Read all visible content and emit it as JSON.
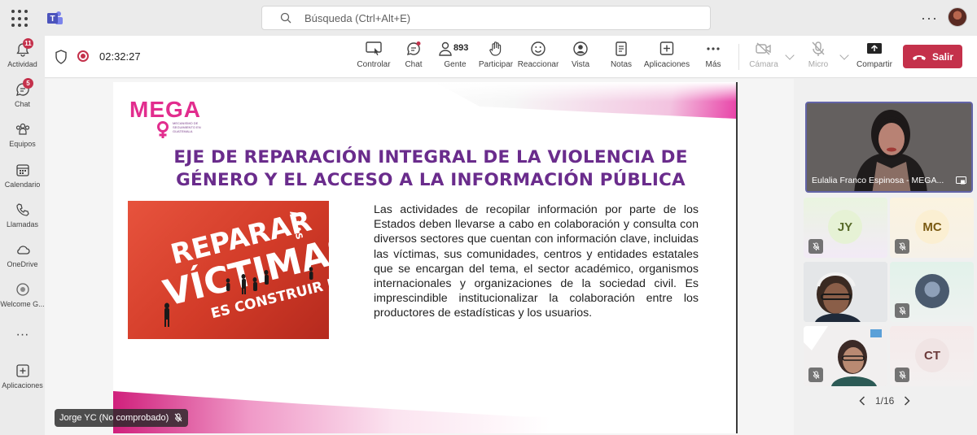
{
  "topbar": {
    "search_placeholder": "Búsqueda (Ctrl+Alt+E)",
    "more_label": "···"
  },
  "rail": {
    "items": [
      {
        "label": "Actividad",
        "badge": "11"
      },
      {
        "label": "Chat",
        "badge": "5"
      },
      {
        "label": "Equipos"
      },
      {
        "label": "Calendario"
      },
      {
        "label": "Llamadas"
      },
      {
        "label": "OneDrive"
      },
      {
        "label": "Welcome G..."
      },
      {
        "label": "···"
      },
      {
        "label": "Aplicaciones"
      }
    ]
  },
  "meeting": {
    "timer": "02:32:27",
    "people_count": "893",
    "toolbar": [
      {
        "label": "Controlar"
      },
      {
        "label": "Chat"
      },
      {
        "label": "Gente"
      },
      {
        "label": "Participar"
      },
      {
        "label": "Reaccionar"
      },
      {
        "label": "Vista"
      },
      {
        "label": "Notas"
      },
      {
        "label": "Aplicaciones"
      },
      {
        "label": "Más"
      },
      {
        "label": "Cámara"
      },
      {
        "label": "Micro"
      },
      {
        "label": "Compartir"
      }
    ],
    "leave_label": "Salir"
  },
  "slide": {
    "logo": "MEGA",
    "logo_sub": "MECANISMO DE SEGUIMIENTO EN GUATEMALA",
    "title_line1": "EJE DE REPARACIÓN INTEGRAL DE LA VIOLENCIA DE",
    "title_line2": "GÉNERO  Y EL ACCESO A LA INFORMACIÓN PÚBLICA",
    "image_text1": "REPARAR",
    "image_text2": "A LAS",
    "image_text3": "VÍCTIMAS",
    "image_text4": "ES CONSTRUIR PAZ",
    "body": "Las actividades de recopilar información por parte de los Estados deben llevarse a cabo en colaboración y consulta con diversos sectores que cuentan con información clave, incluidas las víctimas, sus comunidades, centros y entidades estatales que se encargan del tema, el sector académico, organismos internacionales y organizaciones de la sociedad civil. Es imprescindible institucionalizar la colaboración entre los productores de estadísticas y los usuarios."
  },
  "presenter": {
    "name": "Jorge YC (No comprobado)"
  },
  "gallery": {
    "main_participant": "Eulalia Franco Espinosa - MEGA...",
    "tiles": [
      {
        "initials": "JY",
        "color": "#e6f2d5",
        "text_color": "#586b2a"
      },
      {
        "initials": "MC",
        "color": "#fbefd2",
        "text_color": "#7a5a12"
      },
      {
        "initials": "CT",
        "color": "#f0e4e4",
        "text_color": "#6b3a3a"
      }
    ],
    "page": "1/16"
  }
}
